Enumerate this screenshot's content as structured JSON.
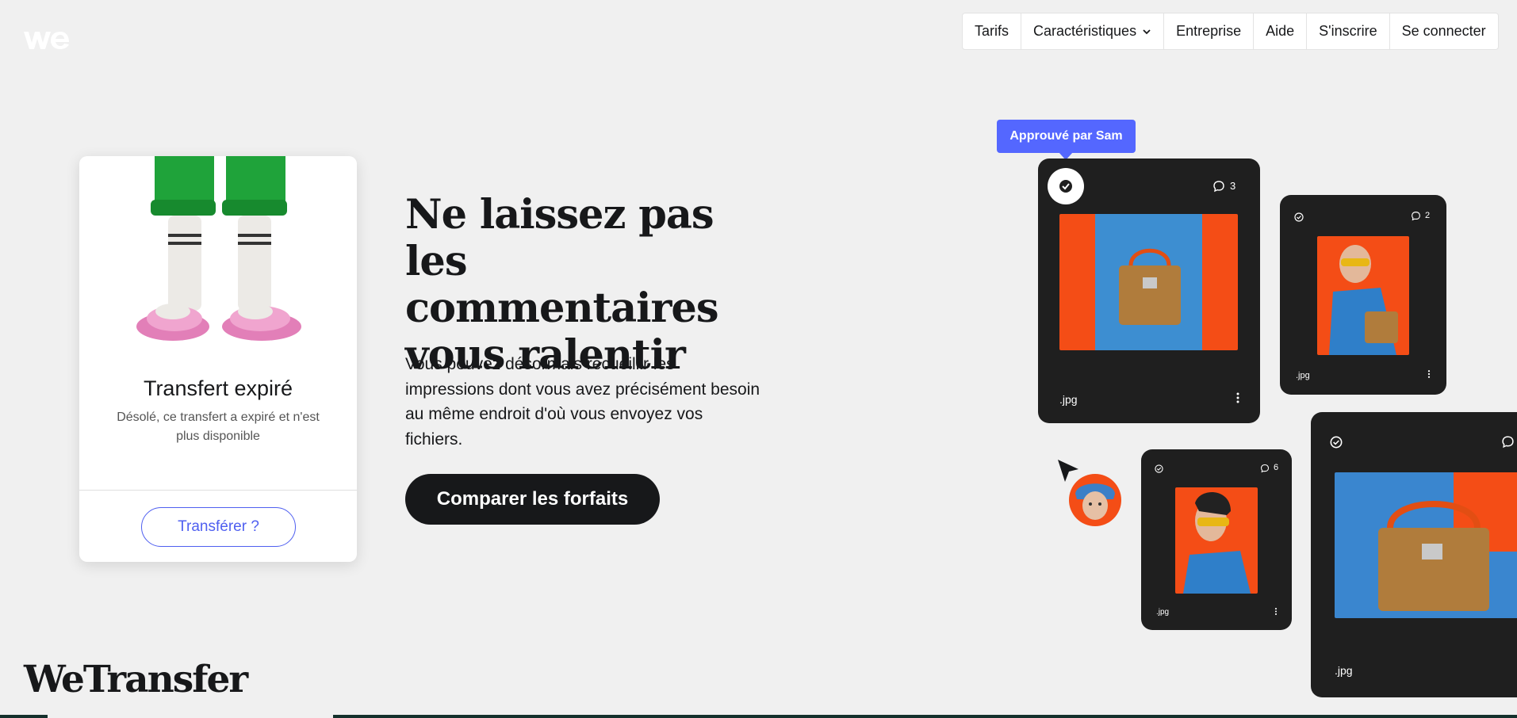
{
  "nav": {
    "items": [
      {
        "label": "Tarifs"
      },
      {
        "label": "Caractéristiques"
      },
      {
        "label": "Entreprise"
      },
      {
        "label": "Aide"
      },
      {
        "label": "S'inscrire"
      },
      {
        "label": "Se connecter"
      }
    ]
  },
  "card": {
    "title": "Transfert expiré",
    "description": "Désolé, ce transfert a expiré et n'est plus disponible",
    "button": "Transférer ?"
  },
  "hero": {
    "title": "Ne laissez pas les commentaires vous ralentir",
    "text": "Vous pouvez désormais recueillir les impressions dont vous avez précisément besoin au même endroit d'où vous envoyez vos fichiers.",
    "cta": "Comparer les forfaits"
  },
  "brand": "WeTransfer",
  "collage": {
    "tooltip": "Approuvé par Sam",
    "tiles": [
      {
        "ext": ".jpg",
        "comments": "3"
      },
      {
        "ext": ".jpg",
        "comments": "2"
      },
      {
        "ext": ".jpg",
        "comments": "6"
      },
      {
        "ext": ".jpg",
        "comments": ""
      }
    ]
  },
  "colors": {
    "accent": "#5467ff",
    "dark": "#17181a",
    "tile": "#1f1f1f",
    "photo_bg": "#f44d16"
  }
}
